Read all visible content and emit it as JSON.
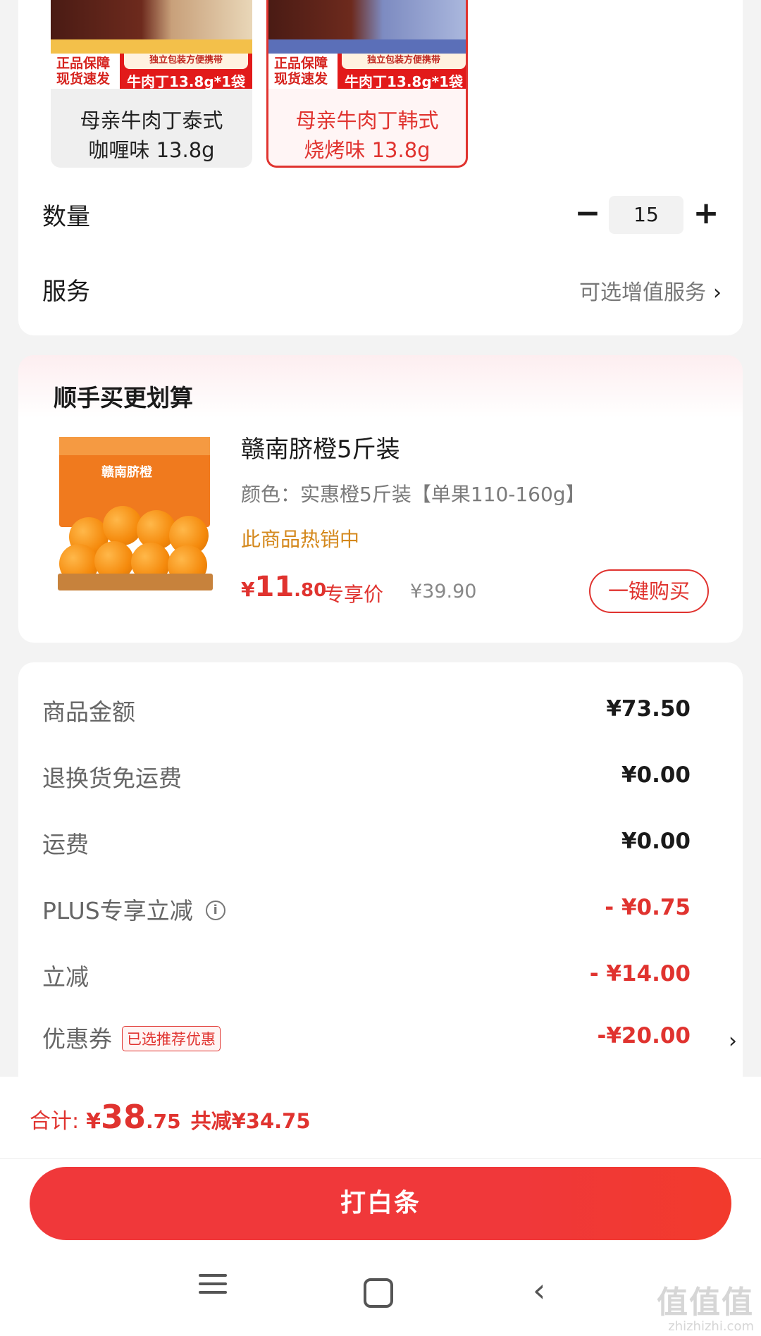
{
  "variants": [
    {
      "badge_line1": "正品保障",
      "badge_line2": "现货速发",
      "tiny": "独立包装方便携带",
      "spec": "牛肉丁13.8g*1袋",
      "name_line1": "母亲牛肉丁泰式",
      "name_line2": "咖喱味 13.8g",
      "selected": false
    },
    {
      "badge_line1": "正品保障",
      "badge_line2": "现货速发",
      "tiny": "独立包装方便携带",
      "spec": "牛肉丁13.8g*1袋",
      "name_line1": "母亲牛肉丁韩式",
      "name_line2": "烧烤味 13.8g",
      "selected": true
    }
  ],
  "quantity": {
    "label": "数量",
    "minus": "−",
    "value": "15",
    "plus": "+"
  },
  "service": {
    "label": "服务",
    "value": "可选增值服务",
    "chevron": "›"
  },
  "recommend": {
    "title": "顺手买更划算",
    "image_label": "赣南脐橙",
    "name": "赣南脐橙5斤装",
    "spec": "颜色：实惠橙5斤装【单果110-160g】",
    "hot": "此商品热销中",
    "price_symbol": "¥",
    "price_int": "11",
    "price_dec": ".80",
    "exclusive": "专享价",
    "original_price": "¥39.90",
    "buy_button": "一键购买"
  },
  "price_details": [
    {
      "label": "商品金额",
      "value": "¥73.50",
      "red": false
    },
    {
      "label": "退换货免运费",
      "value": "¥0.00",
      "red": false
    },
    {
      "label": "运费",
      "value": "¥0.00",
      "red": false
    },
    {
      "label": "PLUS专享立减",
      "value": "- ¥0.75",
      "red": true,
      "info_icon": "i"
    },
    {
      "label": "立减",
      "value": "- ¥14.00",
      "red": true
    },
    {
      "label": "优惠券",
      "value": "-¥20.00",
      "red": true,
      "tag": "已选推荐优惠",
      "chevron": "›"
    }
  ],
  "total": {
    "label": "合计:",
    "symbol": "¥",
    "int": "38",
    "dec": ".75",
    "saving": "共减¥34.75"
  },
  "pay_button": "打白条",
  "system_nav": {
    "back": "‹"
  },
  "watermark": {
    "main": "值值值",
    "sub": "zhizhizhi.com"
  },
  "colors": {
    "accent": "#e0332f",
    "hot": "#d4881c",
    "background": "#f3f3f3"
  }
}
